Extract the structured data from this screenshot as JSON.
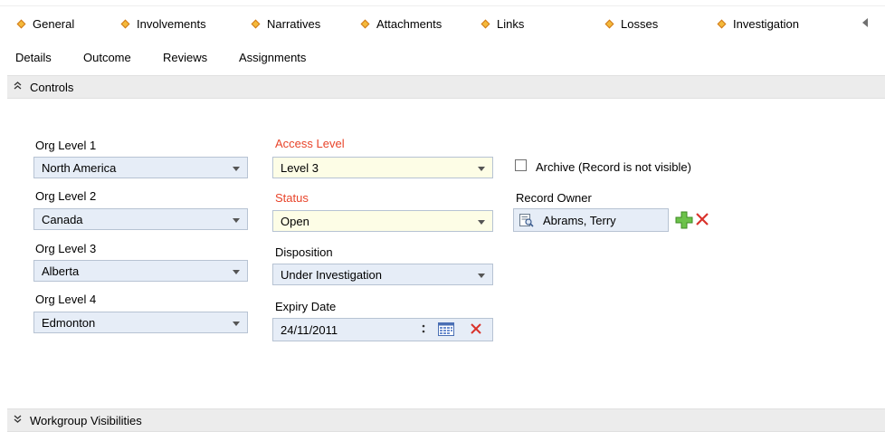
{
  "top_tabs": [
    "General",
    "Involvements",
    "Narratives",
    "Attachments",
    "Links",
    "Losses",
    "Investigation"
  ],
  "sub_tabs": [
    "Details",
    "Outcome",
    "Reviews",
    "Assignments"
  ],
  "controls_section": {
    "title": "Controls"
  },
  "org_levels": [
    {
      "label": "Org Level 1",
      "value": "North America"
    },
    {
      "label": "Org Level 2",
      "value": "Canada"
    },
    {
      "label": "Org Level 3",
      "value": "Alberta"
    },
    {
      "label": "Org Level 4",
      "value": "Edmonton"
    }
  ],
  "access_level": {
    "label": "Access Level",
    "value": "Level 3"
  },
  "status": {
    "label": "Status",
    "value": "Open"
  },
  "disposition": {
    "label": "Disposition",
    "value": "Under Investigation"
  },
  "expiry_date": {
    "label": "Expiry Date",
    "value": "24/11/2011"
  },
  "archive": {
    "label": "Archive (Record is not visible)",
    "checked": false
  },
  "record_owner": {
    "label": "Record Owner",
    "value": "Abrams, Terry"
  },
  "workgroup_section": {
    "title": "Workgroup Visibilities"
  },
  "colors": {
    "required_label": "#e8442a",
    "tab_diamond": "#f4b93a",
    "field_bg": "#e6edf7",
    "required_field_bg": "#fdfde6"
  }
}
